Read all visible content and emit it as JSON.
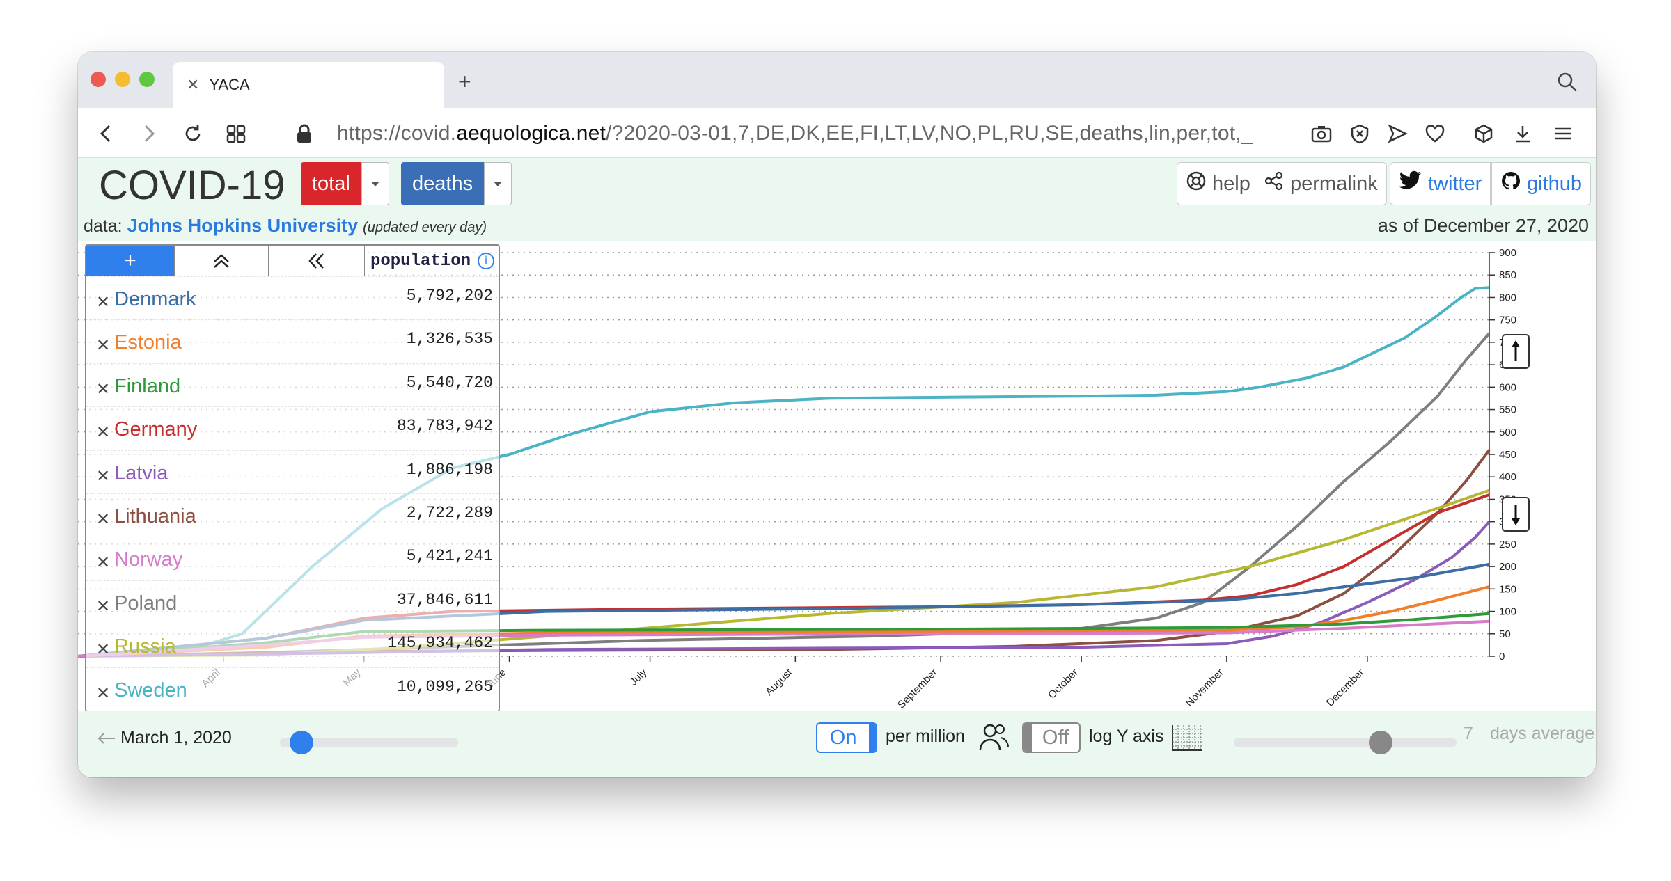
{
  "browser": {
    "tab_title": "YACA",
    "url_prefix": "https://covid.",
    "url_domain": "aequologica.net",
    "url_rest": "/?2020-03-01,7,DE,DK,EE,FI,LT,LV,NO,PL,RU,SE,deaths,lin,per,tot,_"
  },
  "header": {
    "brand": "COVID-19",
    "mode_label": "total",
    "metric_label": "deaths",
    "help_label": "help",
    "permalink_label": "permalink",
    "twitter_label": "twitter",
    "github_label": "github"
  },
  "source": {
    "prefix": "data:",
    "name": "Johns Hopkins University",
    "note": "(updated every day)",
    "as_of": "as of December 27, 2020"
  },
  "table": {
    "add_label": "+",
    "population_header": "population",
    "rows": [
      {
        "name": "Denmark",
        "population": "5,792,202",
        "color": "#3a6ea5"
      },
      {
        "name": "Estonia",
        "population": "1,326,535",
        "color": "#f07e2a"
      },
      {
        "name": "Finland",
        "population": "5,540,720",
        "color": "#2e9a3a"
      },
      {
        "name": "Germany",
        "population": "83,783,942",
        "color": "#c4302f"
      },
      {
        "name": "Latvia",
        "population": "1,886,198",
        "color": "#8a5cb8"
      },
      {
        "name": "Lithuania",
        "population": "2,722,289",
        "color": "#8c5042"
      },
      {
        "name": "Norway",
        "population": "5,421,241",
        "color": "#d77cc8"
      },
      {
        "name": "Poland",
        "population": "37,846,611",
        "color": "#7e7e7e"
      },
      {
        "name": "Russia",
        "population": "145,934,462",
        "color": "#b6b832"
      },
      {
        "name": "Sweden",
        "population": "10,099,265",
        "color": "#4ab3c6"
      }
    ]
  },
  "controls": {
    "start_date": "March 1, 2020",
    "per_million_toggle": "On",
    "per_million_label": "per million",
    "log_toggle": "Off",
    "log_label": "log Y axis",
    "avg_days": "7",
    "avg_label": "days average",
    "date_slider_fraction": 0.12,
    "avg_slider_fraction": 0.66
  },
  "chart_data": {
    "type": "line",
    "title": "",
    "xlabel": "",
    "ylabel": "deaths per million",
    "ylim": [
      0,
      900
    ],
    "y_ticks": [
      0,
      50,
      100,
      150,
      200,
      250,
      300,
      350,
      400,
      450,
      500,
      550,
      600,
      650,
      700,
      750,
      800,
      850,
      900
    ],
    "x_ticks": [
      "April",
      "May",
      "June",
      "July",
      "August",
      "September",
      "October",
      "November",
      "December"
    ],
    "x_tick_days": [
      31,
      61,
      92,
      122,
      153,
      184,
      214,
      245,
      275
    ],
    "x_range_days": [
      0,
      301
    ],
    "grid": true,
    "series": [
      {
        "name": "Sweden",
        "color": "#4ab3c6",
        "points": [
          [
            0,
            0
          ],
          [
            20,
            3
          ],
          [
            35,
            50
          ],
          [
            50,
            200
          ],
          [
            65,
            330
          ],
          [
            80,
            420
          ],
          [
            92,
            450
          ],
          [
            105,
            495
          ],
          [
            122,
            545
          ],
          [
            140,
            565
          ],
          [
            160,
            575
          ],
          [
            190,
            578
          ],
          [
            214,
            580
          ],
          [
            230,
            582
          ],
          [
            245,
            590
          ],
          [
            252,
            600
          ],
          [
            262,
            620
          ],
          [
            270,
            645
          ],
          [
            275,
            670
          ],
          [
            283,
            710
          ],
          [
            290,
            760
          ],
          [
            295,
            800
          ],
          [
            298,
            820
          ],
          [
            301,
            822
          ]
        ]
      },
      {
        "name": "Poland",
        "color": "#7e7e7e",
        "points": [
          [
            0,
            0
          ],
          [
            40,
            8
          ],
          [
            70,
            18
          ],
          [
            120,
            35
          ],
          [
            170,
            45
          ],
          [
            200,
            55
          ],
          [
            214,
            62
          ],
          [
            230,
            85
          ],
          [
            240,
            120
          ],
          [
            250,
            200
          ],
          [
            260,
            290
          ],
          [
            270,
            390
          ],
          [
            280,
            480
          ],
          [
            290,
            580
          ],
          [
            296,
            660
          ],
          [
            301,
            720
          ]
        ]
      },
      {
        "name": "Lithuania",
        "color": "#8c5042",
        "points": [
          [
            0,
            0
          ],
          [
            50,
            10
          ],
          [
            100,
            13
          ],
          [
            160,
            15
          ],
          [
            200,
            22
          ],
          [
            230,
            35
          ],
          [
            245,
            55
          ],
          [
            260,
            90
          ],
          [
            270,
            140
          ],
          [
            280,
            220
          ],
          [
            290,
            320
          ],
          [
            296,
            390
          ],
          [
            301,
            460
          ]
        ]
      },
      {
        "name": "Russia",
        "color": "#b6b832",
        "points": [
          [
            0,
            0
          ],
          [
            40,
            3
          ],
          [
            70,
            20
          ],
          [
            100,
            45
          ],
          [
            130,
            70
          ],
          [
            160,
            95
          ],
          [
            200,
            120
          ],
          [
            230,
            155
          ],
          [
            250,
            200
          ],
          [
            270,
            260
          ],
          [
            290,
            330
          ],
          [
            301,
            370
          ]
        ]
      },
      {
        "name": "Germany",
        "color": "#c4302f",
        "points": [
          [
            0,
            0
          ],
          [
            40,
            40
          ],
          [
            61,
            85
          ],
          [
            80,
            100
          ],
          [
            120,
            105
          ],
          [
            180,
            110
          ],
          [
            214,
            115
          ],
          [
            240,
            125
          ],
          [
            250,
            135
          ],
          [
            260,
            160
          ],
          [
            270,
            200
          ],
          [
            280,
            260
          ],
          [
            290,
            320
          ],
          [
            301,
            360
          ]
        ]
      },
      {
        "name": "Latvia",
        "color": "#8a5cb8",
        "points": [
          [
            0,
            0
          ],
          [
            61,
            8
          ],
          [
            100,
            15
          ],
          [
            160,
            18
          ],
          [
            214,
            20
          ],
          [
            245,
            28
          ],
          [
            255,
            45
          ],
          [
            265,
            75
          ],
          [
            275,
            120
          ],
          [
            285,
            170
          ],
          [
            293,
            220
          ],
          [
            298,
            265
          ],
          [
            301,
            300
          ]
        ]
      },
      {
        "name": "Denmark",
        "color": "#3a6ea5",
        "points": [
          [
            0,
            0
          ],
          [
            40,
            40
          ],
          [
            61,
            80
          ],
          [
            100,
            100
          ],
          [
            160,
            106
          ],
          [
            214,
            115
          ],
          [
            245,
            125
          ],
          [
            260,
            140
          ],
          [
            270,
            155
          ],
          [
            285,
            175
          ],
          [
            301,
            205
          ]
        ]
      },
      {
        "name": "Estonia",
        "color": "#f07e2a",
        "points": [
          [
            0,
            0
          ],
          [
            40,
            20
          ],
          [
            61,
            45
          ],
          [
            100,
            52
          ],
          [
            180,
            55
          ],
          [
            245,
            58
          ],
          [
            260,
            65
          ],
          [
            270,
            80
          ],
          [
            280,
            100
          ],
          [
            290,
            125
          ],
          [
            301,
            155
          ]
        ]
      },
      {
        "name": "Finland",
        "color": "#2e9a3a",
        "points": [
          [
            0,
            0
          ],
          [
            40,
            30
          ],
          [
            61,
            55
          ],
          [
            100,
            58
          ],
          [
            180,
            60
          ],
          [
            245,
            64
          ],
          [
            270,
            72
          ],
          [
            285,
            82
          ],
          [
            301,
            95
          ]
        ]
      },
      {
        "name": "Norway",
        "color": "#d77cc8",
        "points": [
          [
            0,
            0
          ],
          [
            40,
            25
          ],
          [
            61,
            42
          ],
          [
            100,
            47
          ],
          [
            180,
            50
          ],
          [
            245,
            52
          ],
          [
            270,
            62
          ],
          [
            285,
            70
          ],
          [
            301,
            78
          ]
        ]
      }
    ]
  }
}
